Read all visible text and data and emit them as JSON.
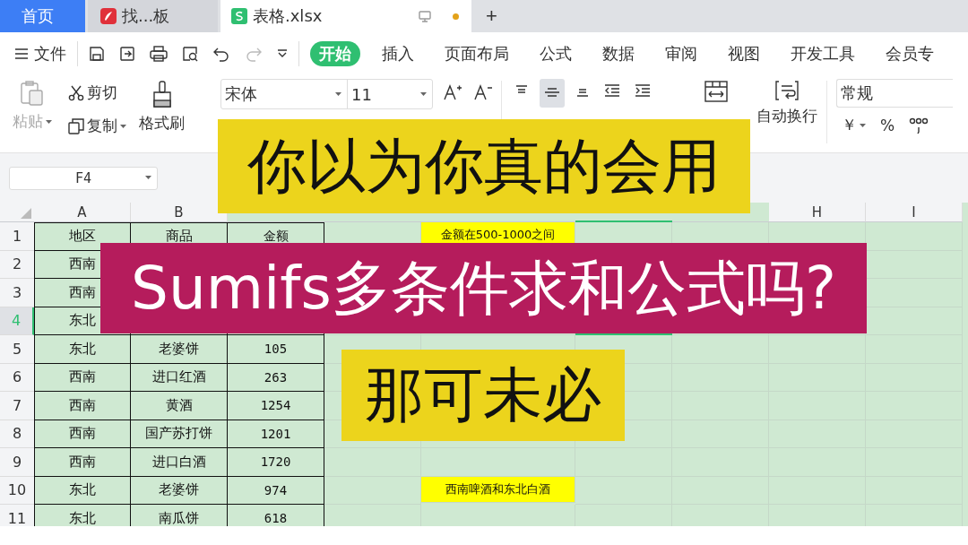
{
  "tabs": [
    {
      "label": "首页",
      "kind": "home",
      "selected": false,
      "modified": false
    },
    {
      "label": "找...板",
      "kind": "doc",
      "selected": false,
      "modified": false
    },
    {
      "label": "表格.xlsx",
      "kind": "sheet",
      "selected": true,
      "modified": true
    }
  ],
  "new_tab": "+",
  "menu": {
    "file": "文件",
    "tabs": [
      {
        "label": "开始",
        "selected": true
      },
      {
        "label": "插入",
        "selected": false
      },
      {
        "label": "页面布局",
        "selected": false
      },
      {
        "label": "公式",
        "selected": false
      },
      {
        "label": "数据",
        "selected": false
      },
      {
        "label": "审阅",
        "selected": false
      },
      {
        "label": "视图",
        "selected": false
      },
      {
        "label": "开发工具",
        "selected": false
      },
      {
        "label": "会员专",
        "selected": false
      }
    ]
  },
  "ribbon": {
    "paste": {
      "label": "粘贴",
      "disabled": true
    },
    "cut": "剪切",
    "copy": "复制",
    "format_painter": "格式刷",
    "font": "宋体",
    "font_size": "11",
    "wrap_text": "自动换行",
    "number_format": "常规",
    "currency": "￥",
    "percent": "%"
  },
  "name_box": "F4",
  "columns": [
    {
      "label": "A",
      "selected": false
    },
    {
      "label": "B",
      "selected": false
    },
    {
      "selected": false
    },
    {
      "selected": false
    },
    {
      "selected": false
    },
    {
      "selected": true
    },
    {
      "selected": false
    },
    {
      "label": "H",
      "selected": false
    },
    {
      "label": "I",
      "selected": false
    }
  ],
  "rows": [
    {
      "number": "1",
      "selected": false,
      "cells": [
        "地区",
        "商品",
        "金额"
      ],
      "note": "金额在500-1000之间"
    },
    {
      "number": "2",
      "selected": false,
      "cells": [
        "西南"
      ]
    },
    {
      "number": "3",
      "selected": false,
      "cells": [
        "西南"
      ]
    },
    {
      "number": "4",
      "selected": true,
      "cells": [
        "东北"
      ]
    },
    {
      "number": "5",
      "selected": false,
      "cells": [
        "东北",
        "老婆饼",
        "105"
      ]
    },
    {
      "number": "6",
      "selected": false,
      "cells": [
        "西南",
        "进口红酒",
        "263"
      ]
    },
    {
      "number": "7",
      "selected": false,
      "cells": [
        "西南",
        "黄酒",
        "1254"
      ]
    },
    {
      "number": "8",
      "selected": false,
      "cells": [
        "西南",
        "国产苏打饼",
        "1201"
      ]
    },
    {
      "number": "9",
      "selected": false,
      "cells": [
        "西南",
        "进口白酒",
        "1720"
      ]
    },
    {
      "number": "10",
      "selected": false,
      "cells": [
        "东北",
        "老婆饼",
        "974"
      ],
      "note": "西南啤酒和东北白酒"
    },
    {
      "number": "11",
      "selected": false,
      "cells": [
        "东北",
        "南瓜饼",
        "618"
      ]
    }
  ],
  "captions": [
    {
      "text": "你以为你真的会用",
      "kind": "highlight"
    },
    {
      "text": "Sumifs多条件求和公式吗?",
      "kind": "accent"
    },
    {
      "text": "那可未必",
      "kind": "highlight"
    }
  ]
}
